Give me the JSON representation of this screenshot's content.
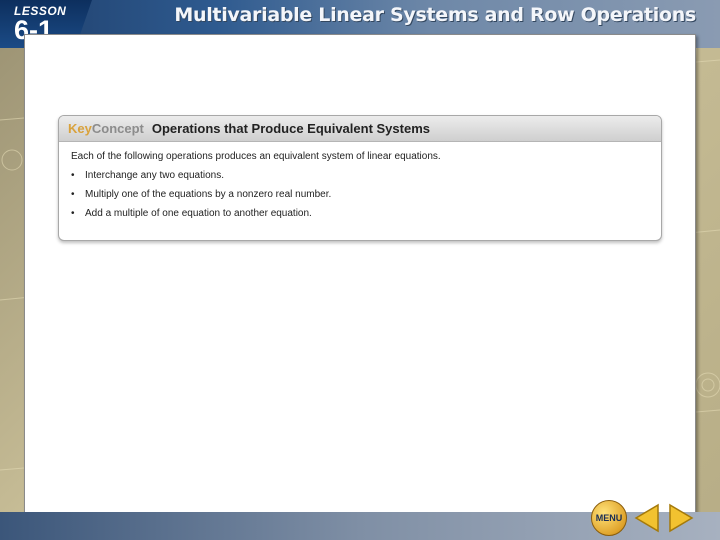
{
  "header": {
    "lesson_label": "LESSON",
    "lesson_number": "6-1",
    "title": "Multivariable Linear Systems and Row Operations"
  },
  "key_concept": {
    "label_key": "Key",
    "label_concept": "Concept",
    "title": "Operations that Produce Equivalent Systems",
    "intro": "Each of the following operations produces an equivalent system of linear equations.",
    "bullets": [
      "Interchange any two equations.",
      "Multiply one of the equations by a nonzero real number.",
      "Add a multiple of one equation to another equation."
    ]
  },
  "nav": {
    "menu_label": "MENU"
  },
  "colors": {
    "header_blue": "#1b4b86",
    "key_gold": "#d9a23c",
    "menu_gold": "#e0a42c",
    "arrow_gold": "#f2c230"
  },
  "icons": [
    "menu-icon",
    "left-arrow-icon",
    "right-arrow-icon"
  ]
}
